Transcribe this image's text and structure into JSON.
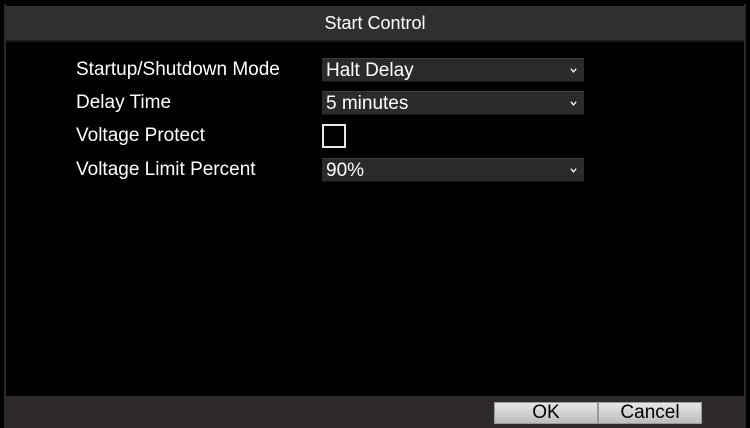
{
  "dialog": {
    "title": "Start Control"
  },
  "form": {
    "startup_mode": {
      "label": "Startup/Shutdown Mode",
      "value": "Halt Delay"
    },
    "delay_time": {
      "label": "Delay Time",
      "value": "5 minutes"
    },
    "voltage_protect": {
      "label": "Voltage Protect",
      "checked": false
    },
    "voltage_limit": {
      "label": "Voltage Limit Percent",
      "value": "90%"
    }
  },
  "buttons": {
    "ok_label": "OK",
    "cancel_label": "Cancel"
  },
  "icons": {
    "dropdown": "chevron-down-icon"
  }
}
